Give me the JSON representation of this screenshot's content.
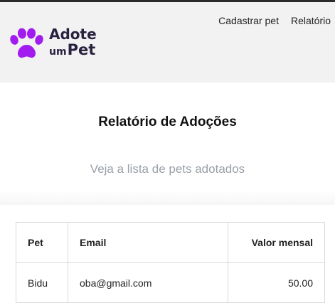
{
  "brand": {
    "line1": "Adote",
    "line2_small": "um",
    "line2_big": "Pet",
    "accent": "#a21cf0",
    "text_color": "#2a2140"
  },
  "nav": {
    "items": [
      {
        "label": "Cadastrar pet"
      },
      {
        "label": "Relatório"
      }
    ]
  },
  "page": {
    "title": "Relatório de Adoções",
    "subtitle": "Veja a lista de pets adotados"
  },
  "table": {
    "headers": {
      "pet": "Pet",
      "email": "Email",
      "value": "Valor mensal"
    },
    "rows": [
      {
        "pet": "Bidu",
        "email": "oba@gmail.com",
        "value": "50.00"
      }
    ]
  }
}
